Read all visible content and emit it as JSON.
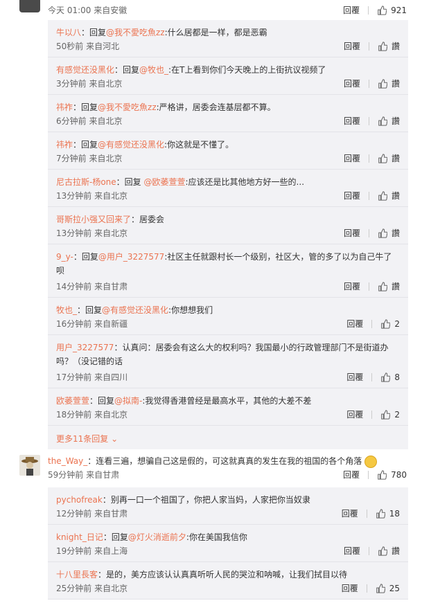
{
  "top": {
    "time_source": "今天 01:00 来自安徽",
    "reply_label": "回覆",
    "like_count": "921"
  },
  "replies1": [
    {
      "nick": "牛以八",
      "prefix": "：回复",
      "at": "@我不愛吃魚zz",
      "content": ":什么居都是一样，都是恶霸",
      "meta": "50秒前 来自河北",
      "reply_label": "回覆",
      "like": "讚"
    },
    {
      "nick": "有感觉还没黑化",
      "prefix": "：回复",
      "at": "@牧也_",
      "content": ":在T上看到你们今天晚上的上街抗议视频了",
      "meta": "3分钟前 来自北京",
      "reply_label": "回覆",
      "like": "讚"
    },
    {
      "nick": "祎祚",
      "prefix": "：回复",
      "at": "@我不愛吃魚zz",
      "content": ":严格讲，居委会连基层都不算。",
      "meta": "6分钟前 来自北京",
      "reply_label": "回覆",
      "like": "讚"
    },
    {
      "nick": "祎祚",
      "prefix": "：回复",
      "at": "@有感觉还没黑化",
      "content": ":你这就是不懂了。",
      "meta": "7分钟前 来自北京",
      "reply_label": "回覆",
      "like": "讚"
    },
    {
      "nick": "尼古拉斯-杨one",
      "prefix": "：回复 ",
      "at": "@欧萎萱萱",
      "content": ":应该还是比其他地方好一些的...",
      "meta": "13分钟前 来自北京",
      "reply_label": "回覆",
      "like": "讚"
    },
    {
      "nick": "哥斯拉小强又回来了",
      "prefix": "：居委会",
      "at": "",
      "content": "",
      "meta": "13分钟前 来自北京",
      "reply_label": "回覆",
      "like": "讚"
    },
    {
      "nick": "9_y-",
      "prefix": "：回复",
      "at": "@用户_3227577",
      "content": ":社区主任就跟村长一个级别，社区大，管的多了以为自己牛了呗",
      "meta": "14分钟前 来自甘肃",
      "reply_label": "回覆",
      "like": "讚",
      "tall": true
    },
    {
      "nick": "牧也_",
      "prefix": "：回复",
      "at": "@有感觉还没黑化",
      "content": ":你想想我们",
      "meta": "16分钟前 来自新疆",
      "reply_label": "回覆",
      "like": "2"
    },
    {
      "nick": "用户_3227577",
      "prefix": "：认真问：居委会有这么大的权利吗？我国最小的行政管理部门不是街道办吗？（没记错的话",
      "at": "",
      "content": "",
      "meta": "17分钟前 来自四川",
      "reply_label": "回覆",
      "like": "8",
      "tall": true
    },
    {
      "nick": "欧萎萱萱",
      "prefix": "：回复",
      "at": "@拟南-",
      "content": ":我觉得香港曾经是最高水平，其他的大差不差",
      "meta": "18分钟前 来自北京",
      "reply_label": "回覆",
      "like": "2"
    }
  ],
  "more_label": "更多11条回复",
  "main": {
    "nick": "the_Way_",
    "content": "：连看三遍，想骗自己这是假的，可这就真真的发生在我的祖国的各个角落",
    "meta": "59分钟前 来自甘肃",
    "reply_label": "回覆",
    "like_count": "780"
  },
  "replies2": [
    {
      "nick": "pychofreak",
      "prefix": "：别再一口一个祖国了，你把人家当妈，人家把你当奴隶",
      "at": "",
      "content": "",
      "meta": "12分钟前 来自甘肃",
      "reply_label": "回覆",
      "like": "18"
    },
    {
      "nick": "knight_日记",
      "prefix": "：回复",
      "at": "@灯火消逝前夕",
      "content": ":你在美国我信你",
      "meta": "19分钟前 来自上海",
      "reply_label": "回覆",
      "like": "讚"
    },
    {
      "nick": "十八里長客",
      "prefix": "：是的，美方应该认认真真听听人民的哭泣和呐喊，让我们拭目以待",
      "at": "",
      "content": "",
      "meta": "25分钟前 来自北京",
      "reply_label": "回覆",
      "like": "25"
    }
  ]
}
